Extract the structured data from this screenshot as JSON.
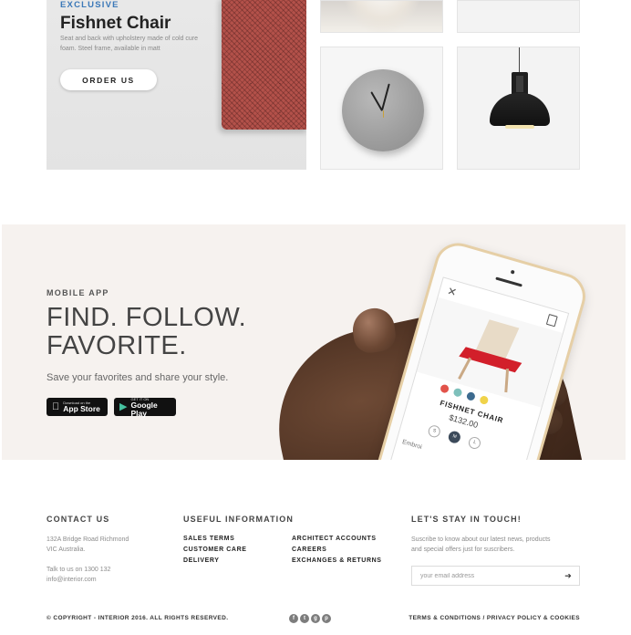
{
  "hero": {
    "eyebrow": "EXCLUSIVE",
    "title": "Fishnet Chair",
    "description": "Seat and back with upholstery made of cold cure foam. Steel frame, available in matt",
    "cta_label": "ORDER US"
  },
  "app_promo": {
    "eyebrow": "MOBILE APP",
    "title_line1": "FIND. FOLLOW.",
    "title_line2": "FAVORITE.",
    "subtitle": "Save your favorites and share your style.",
    "app_store": {
      "small": "Download on the",
      "big": "App Store",
      "icon": "apple-icon"
    },
    "google_play": {
      "small": "GET IT ON",
      "big": "Google Play",
      "icon": "play-icon"
    },
    "phone_screen": {
      "close_glyph": "✕",
      "product_name": "FISHNET CHAIR",
      "price": "$132.00",
      "swatches": [
        "#e2534a",
        "#7ec0bb",
        "#3d6b8f",
        "#f0d34a"
      ],
      "sizes": [
        "S",
        "M",
        "L"
      ],
      "active_size": "M",
      "partial_label": "Embroi"
    }
  },
  "footer": {
    "contact": {
      "heading": "CONTACT US",
      "address_line1": "132A Bridge Road Richmond",
      "address_line2": "VIC Australia.",
      "phone": "Talk to us on 1300 132",
      "email": "info@interior.com"
    },
    "useful": {
      "heading": "USEFUL INFORMATION",
      "col1": [
        "SALES TERMS",
        "CUSTOMER CARE",
        "DELIVERY"
      ],
      "col2": [
        "ARCHITECT ACCOUNTS",
        "CAREERS",
        "EXCHANGES & RETURNS"
      ]
    },
    "newsletter": {
      "heading": "LET'S STAY IN TOUCH!",
      "text_line1": "Suscribe to know about our latest news, products",
      "text_line2": "and special offers just for suscribers.",
      "placeholder": "your email address",
      "submit_glyph": "➔"
    },
    "copyright": "© COPYRIGHT - INTERIOR 2016. ALL RIGHTS RESERVED.",
    "socials": [
      {
        "name": "facebook-icon",
        "glyph": "f"
      },
      {
        "name": "twitter-icon",
        "glyph": "t"
      },
      {
        "name": "google-plus-icon",
        "glyph": "g"
      },
      {
        "name": "pinterest-icon",
        "glyph": "p"
      }
    ],
    "legal": {
      "terms": "TERMS & CONDITIONS",
      "separator": "/",
      "privacy": "PRIVACY POLICY & COOKIES"
    }
  },
  "colors": {
    "accent": "#3b78b8",
    "promo_bg": "#f6f2ef",
    "chair_red": "#d21f2a"
  }
}
